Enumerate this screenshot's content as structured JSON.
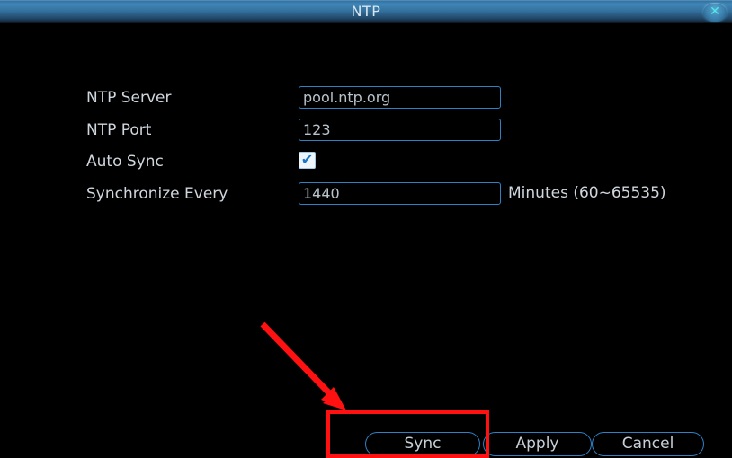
{
  "window": {
    "title": "NTP",
    "close_icon": "close-icon",
    "close_glyph": "✕"
  },
  "colors": {
    "titlebar_blue": "#3f86b8",
    "field_border": "#2f81c4",
    "text": "#cfd6dd",
    "accent_close": "#4fe8e8",
    "annotation_red": "#ff1111",
    "background": "#000000"
  },
  "form": {
    "rows": [
      {
        "label": "NTP Server",
        "type": "text",
        "value": "pool.ntp.org",
        "placeholder": "pool.ntp.org",
        "suffix": ""
      },
      {
        "label": "NTP Port",
        "type": "text",
        "value": "123",
        "placeholder": "123",
        "suffix": ""
      },
      {
        "label": "Auto Sync",
        "type": "checkbox",
        "checked": true,
        "check_glyph": "✔",
        "suffix": ""
      },
      {
        "label": "Synchronize Every",
        "type": "text",
        "value": "1440",
        "placeholder": "1440",
        "suffix": "Minutes (60~65535)"
      }
    ]
  },
  "buttons": {
    "sync": "Sync",
    "apply": "Apply",
    "cancel": "Cancel"
  },
  "annotations": {
    "highlight_target": "Sync",
    "arrow": "red-arrow-pointing-to-sync-button"
  }
}
